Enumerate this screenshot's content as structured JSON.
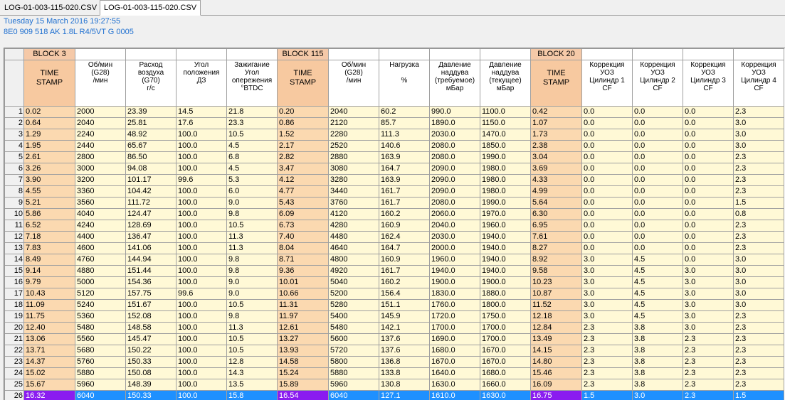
{
  "tabs": [
    "LOG-01-003-115-020.CSV",
    "LOG-01-003-115-020.CSV"
  ],
  "info": {
    "line1": "Tuesday 15 March 2016 19:27:55",
    "line2": "8E0 909 518 AK  1.8L R4/5VT     G   0005"
  },
  "blocks": [
    "BLOCK 3",
    "BLOCK 115",
    "BLOCK 20"
  ],
  "headers": [
    "TIME\nSTAMP",
    "Об/мин\n(G28)\n/мин",
    "Расход\nвоздуха\n(G70)\nг/с",
    "Угол\nположения\nДЗ",
    "Зажигание\nУгол\nопережения\n°BTDC",
    "TIME\nSTAMP",
    "Об/мин\n(G28)\n/мин",
    "Нагрузка\n\n%",
    "Давление\nнаддува\n(требуемое)\nмБар",
    "Давление\nнаддува\n(текущее)\nмБар",
    "TIME\nSTAMP",
    "Коррекция\nУОЗ\nЦилиндр 1\nCF",
    "Коррекция\nУОЗ\nЦилиндр 2\nCF",
    "Коррекция\nУОЗ\nЦилиндр 3\nCF",
    "Коррекция\nУОЗ\nЦилиндр 4\nCF"
  ],
  "rows": [
    [
      "0.02",
      "2000",
      "23.39",
      "14.5",
      "21.8",
      "0.20",
      "2040",
      "60.2",
      "990.0",
      "1100.0",
      "0.42",
      "0.0",
      "0.0",
      "0.0",
      "2.3"
    ],
    [
      "0.64",
      "2040",
      "25.81",
      "17.6",
      "23.3",
      "0.86",
      "2120",
      "85.7",
      "1890.0",
      "1150.0",
      "1.07",
      "0.0",
      "0.0",
      "0.0",
      "3.0"
    ],
    [
      "1.29",
      "2240",
      "48.92",
      "100.0",
      "10.5",
      "1.52",
      "2280",
      "111.3",
      "2030.0",
      "1470.0",
      "1.73",
      "0.0",
      "0.0",
      "0.0",
      "3.0"
    ],
    [
      "1.95",
      "2440",
      "65.67",
      "100.0",
      "4.5",
      "2.17",
      "2520",
      "140.6",
      "2080.0",
      "1850.0",
      "2.38",
      "0.0",
      "0.0",
      "0.0",
      "3.0"
    ],
    [
      "2.61",
      "2800",
      "86.50",
      "100.0",
      "6.8",
      "2.82",
      "2880",
      "163.9",
      "2080.0",
      "1990.0",
      "3.04",
      "0.0",
      "0.0",
      "0.0",
      "2.3"
    ],
    [
      "3.26",
      "3000",
      "94.08",
      "100.0",
      "4.5",
      "3.47",
      "3080",
      "164.7",
      "2090.0",
      "1980.0",
      "3.69",
      "0.0",
      "0.0",
      "0.0",
      "2.3"
    ],
    [
      "3.90",
      "3200",
      "101.17",
      "99.6",
      "5.3",
      "4.12",
      "3280",
      "163.9",
      "2090.0",
      "1980.0",
      "4.33",
      "0.0",
      "0.0",
      "0.0",
      "2.3"
    ],
    [
      "4.55",
      "3360",
      "104.42",
      "100.0",
      "6.0",
      "4.77",
      "3440",
      "161.7",
      "2090.0",
      "1980.0",
      "4.99",
      "0.0",
      "0.0",
      "0.0",
      "2.3"
    ],
    [
      "5.21",
      "3560",
      "111.72",
      "100.0",
      "9.0",
      "5.43",
      "3760",
      "161.7",
      "2080.0",
      "1990.0",
      "5.64",
      "0.0",
      "0.0",
      "0.0",
      "1.5"
    ],
    [
      "5.86",
      "4040",
      "124.47",
      "100.0",
      "9.8",
      "6.09",
      "4120",
      "160.2",
      "2060.0",
      "1970.0",
      "6.30",
      "0.0",
      "0.0",
      "0.0",
      "0.8"
    ],
    [
      "6.52",
      "4240",
      "128.69",
      "100.0",
      "10.5",
      "6.73",
      "4280",
      "160.9",
      "2040.0",
      "1960.0",
      "6.95",
      "0.0",
      "0.0",
      "0.0",
      "2.3"
    ],
    [
      "7.18",
      "4400",
      "136.47",
      "100.0",
      "11.3",
      "7.40",
      "4480",
      "162.4",
      "2030.0",
      "1940.0",
      "7.61",
      "0.0",
      "0.0",
      "0.0",
      "2.3"
    ],
    [
      "7.83",
      "4600",
      "141.06",
      "100.0",
      "11.3",
      "8.04",
      "4640",
      "164.7",
      "2000.0",
      "1940.0",
      "8.27",
      "0.0",
      "0.0",
      "0.0",
      "2.3"
    ],
    [
      "8.49",
      "4760",
      "144.94",
      "100.0",
      "9.8",
      "8.71",
      "4800",
      "160.9",
      "1960.0",
      "1940.0",
      "8.92",
      "3.0",
      "4.5",
      "0.0",
      "3.0"
    ],
    [
      "9.14",
      "4880",
      "151.44",
      "100.0",
      "9.8",
      "9.36",
      "4920",
      "161.7",
      "1940.0",
      "1940.0",
      "9.58",
      "3.0",
      "4.5",
      "3.0",
      "3.0"
    ],
    [
      "9.79",
      "5000",
      "154.36",
      "100.0",
      "9.0",
      "10.01",
      "5040",
      "160.2",
      "1900.0",
      "1900.0",
      "10.23",
      "3.0",
      "4.5",
      "3.0",
      "3.0"
    ],
    [
      "10.43",
      "5120",
      "157.75",
      "99.6",
      "9.0",
      "10.66",
      "5200",
      "156.4",
      "1830.0",
      "1880.0",
      "10.87",
      "3.0",
      "4.5",
      "3.0",
      "3.0"
    ],
    [
      "11.09",
      "5240",
      "151.67",
      "100.0",
      "10.5",
      "11.31",
      "5280",
      "151.1",
      "1760.0",
      "1800.0",
      "11.52",
      "3.0",
      "4.5",
      "3.0",
      "3.0"
    ],
    [
      "11.75",
      "5360",
      "152.08",
      "100.0",
      "9.8",
      "11.97",
      "5400",
      "145.9",
      "1720.0",
      "1750.0",
      "12.18",
      "3.0",
      "4.5",
      "3.0",
      "2.3"
    ],
    [
      "12.40",
      "5480",
      "148.58",
      "100.0",
      "11.3",
      "12.61",
      "5480",
      "142.1",
      "1700.0",
      "1700.0",
      "12.84",
      "2.3",
      "3.8",
      "3.0",
      "2.3"
    ],
    [
      "13.06",
      "5560",
      "145.47",
      "100.0",
      "10.5",
      "13.27",
      "5600",
      "137.6",
      "1690.0",
      "1700.0",
      "13.49",
      "2.3",
      "3.8",
      "2.3",
      "2.3"
    ],
    [
      "13.71",
      "5680",
      "150.22",
      "100.0",
      "10.5",
      "13.93",
      "5720",
      "137.6",
      "1680.0",
      "1670.0",
      "14.15",
      "2.3",
      "3.8",
      "2.3",
      "2.3"
    ],
    [
      "14.37",
      "5760",
      "150.33",
      "100.0",
      "12.8",
      "14.58",
      "5800",
      "136.8",
      "1670.0",
      "1670.0",
      "14.80",
      "2.3",
      "3.8",
      "2.3",
      "2.3"
    ],
    [
      "15.02",
      "5880",
      "150.08",
      "100.0",
      "14.3",
      "15.24",
      "5880",
      "133.8",
      "1640.0",
      "1680.0",
      "15.46",
      "2.3",
      "3.8",
      "2.3",
      "2.3"
    ],
    [
      "15.67",
      "5960",
      "148.39",
      "100.0",
      "13.5",
      "15.89",
      "5960",
      "130.8",
      "1630.0",
      "1660.0",
      "16.09",
      "2.3",
      "3.8",
      "2.3",
      "2.3"
    ],
    [
      "16.32",
      "6040",
      "150.33",
      "100.0",
      "15.8",
      "16.54",
      "6040",
      "127.1",
      "1610.0",
      "1630.0",
      "16.75",
      "1.5",
      "3.0",
      "2.3",
      "1.5"
    ]
  ],
  "selected_row": 26
}
